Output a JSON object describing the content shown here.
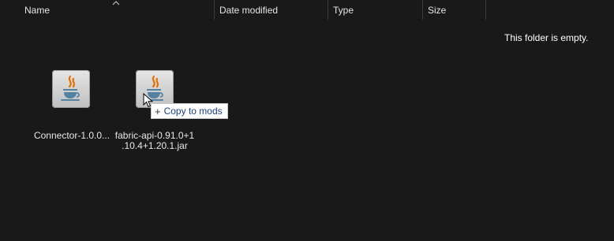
{
  "columns": {
    "name": "Name",
    "date_modified": "Date modified",
    "type": "Type",
    "size": "Size"
  },
  "sort": {
    "column": "name",
    "direction": "ascending",
    "icon": "sort-up-icon"
  },
  "empty_message": "This folder is empty.",
  "dragged_files": [
    {
      "label_line1": "Connector-1.0.0...",
      "label_line2": "",
      "icon": "java-file-icon"
    },
    {
      "label_line1": "fabric-api-0.91.0+1",
      "label_line2": ".10.4+1.20.1.jar",
      "icon": "java-file-icon"
    }
  ],
  "drag_tooltip": {
    "action_icon": "plus-icon",
    "text": "Copy to mods"
  },
  "colors": {
    "background": "#191919",
    "header_text": "#e6e6e6",
    "tooltip_text": "#1e3f8a",
    "java_flame": "#e76f00",
    "java_cup": "#5382a1"
  }
}
